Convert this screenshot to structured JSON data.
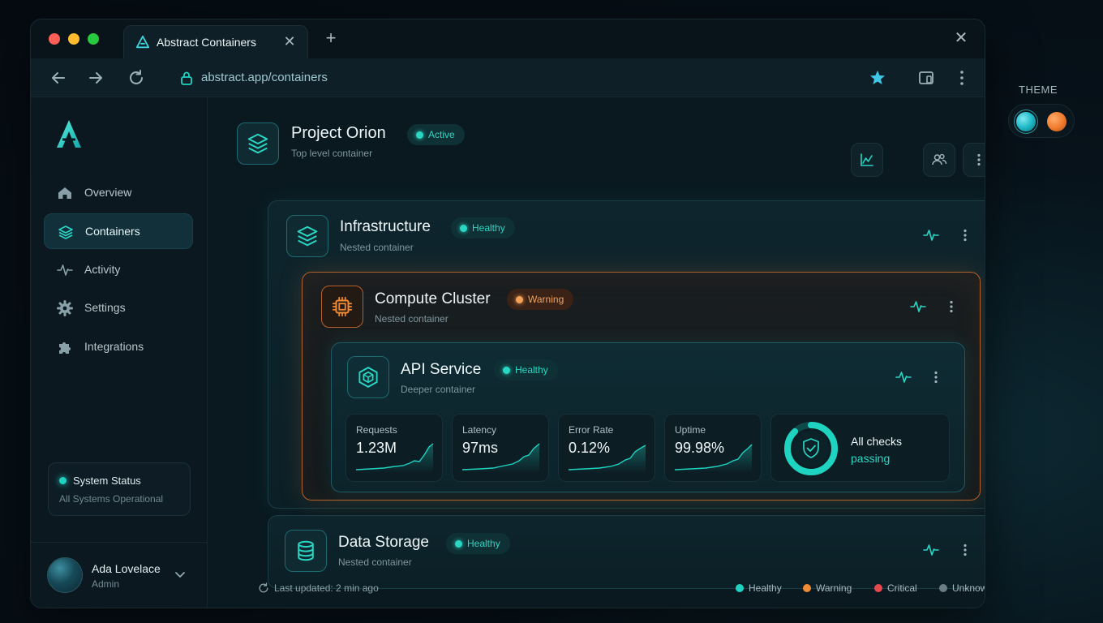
{
  "browser": {
    "tab_title": "Abstract Containers",
    "url": "abstract.app/containers"
  },
  "sidebar": {
    "items": [
      {
        "label": "Overview",
        "icon": "home-icon"
      },
      {
        "label": "Containers",
        "icon": "layers-icon",
        "active": true
      },
      {
        "label": "Activity",
        "icon": "activity-icon"
      },
      {
        "label": "Settings",
        "icon": "gear-icon"
      },
      {
        "label": "Integrations",
        "icon": "puzzle-icon"
      }
    ],
    "status": {
      "title": "System Status",
      "subtitle": "All Systems Operational"
    },
    "user": {
      "name": "Ada Lovelace",
      "role": "Admin"
    }
  },
  "project": {
    "title": "Project Orion",
    "subtitle": "Top level container",
    "badge": "Active"
  },
  "infrastructure": {
    "title": "Infrastructure",
    "subtitle": "Nested container",
    "badge": "Healthy"
  },
  "compute": {
    "title": "Compute Cluster",
    "subtitle": "Nested container",
    "badge": "Warning"
  },
  "api": {
    "title": "API Service",
    "subtitle": "Deeper container",
    "badge": "Healthy",
    "metrics": [
      {
        "label": "Requests",
        "value": "1.23M"
      },
      {
        "label": "Latency",
        "value": "97ms"
      },
      {
        "label": "Error Rate",
        "value": "0.12%"
      },
      {
        "label": "Uptime",
        "value": "99.98%"
      }
    ],
    "checks": {
      "title": "All checks",
      "status": "passing"
    }
  },
  "storage": {
    "title": "Data Storage",
    "subtitle": "Nested container",
    "badge": "Healthy"
  },
  "footer": {
    "updated": "Last updated: 2 min ago",
    "legend": [
      {
        "label": "Healthy",
        "color": "#1fd3c1"
      },
      {
        "label": "Warning",
        "color": "#f08a33"
      },
      {
        "label": "Critical",
        "color": "#e5484d"
      },
      {
        "label": "Unknown",
        "color": "#6b7d85"
      }
    ]
  },
  "theme": {
    "label": "THEME",
    "options": [
      {
        "color": "#1fb9c6"
      },
      {
        "color": "#f07a2a"
      }
    ]
  },
  "colors": {
    "accent": "#1fd3c1",
    "warning": "#f08a33"
  }
}
